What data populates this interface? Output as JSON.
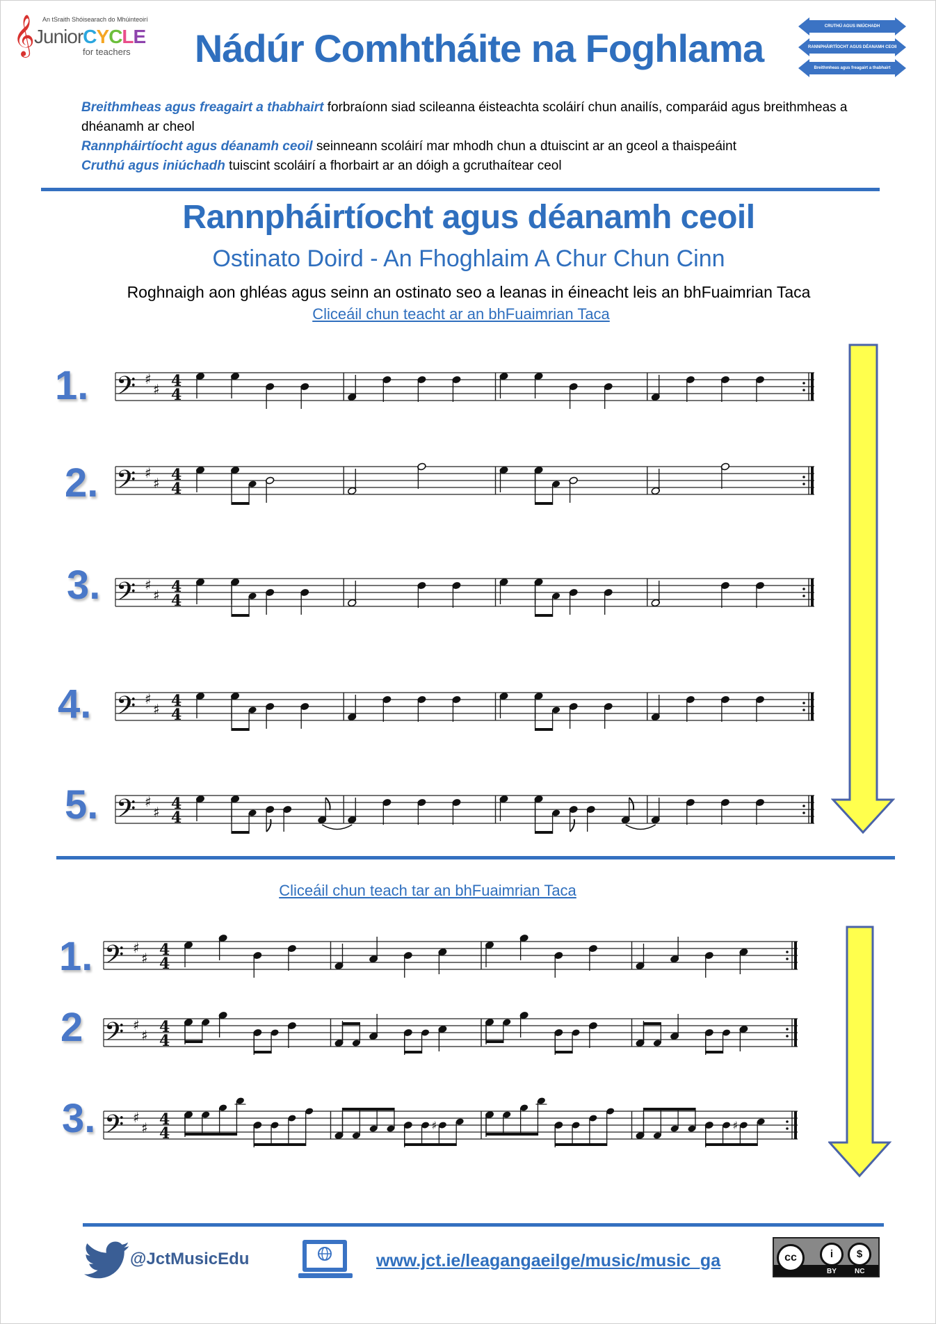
{
  "header": {
    "logo": {
      "tagline": "An tSraith Shóisearach do Mhúinteoirí",
      "junior": "Junior",
      "cycle_letters": [
        "C",
        "Y",
        "C",
        "L",
        "E"
      ],
      "for_teachers": "for teachers"
    },
    "title": "Nádúr Comhtháite na Foghlama",
    "strand_arrows": [
      "CRUTHÚ AGUS INIÚCHADH",
      "RANNPHÁIRTÍOCHT AGUS DÉANAMH CEOIL",
      "Breithmheas agus freagairt a thabhairt"
    ]
  },
  "intro": [
    {
      "emphasis": "Breithmheas agus freagairt a thabhairt",
      "text": " forbraíonn siad scileanna éisteachta scoláirí chun anailís, comparáid agus breithmheas a dhéanamh ar cheol"
    },
    {
      "emphasis": "Rannpháirtíocht agus déanamh ceoil",
      "text": " seinneann scoláirí mar mhodh chun a dtuiscint ar an gceol a thaispeáint"
    },
    {
      "emphasis": "Cruthú agus iniúchadh",
      "text": " tuiscint scoláirí a fhorbairt ar an dóigh a gcruthaítear ceol"
    }
  ],
  "section": {
    "heading": "Rannpháirtíocht agus déanamh ceoil",
    "subheading": "Ostinato Doird - An Fhoghlaim A Chur Chun Cinn",
    "instruction": "Roghnaigh aon ghléas agus seinn an ostinato seo a leanas in éineacht leis an bhFuaimrian Taca",
    "link1": "Cliceáil chun teacht ar an bhFuaimrian Taca",
    "link2": "Cliceáil chun teach tar an bhFuaimrian Taca"
  },
  "music": {
    "clef": "bass",
    "key_signature": [
      "F#",
      "C#"
    ],
    "time_signature": "4/4",
    "end_barline": "repeat",
    "set1": [
      {
        "label": "1.",
        "measures": [
          [
            [
              "G3",
              1
            ],
            [
              "G3",
              1
            ],
            [
              "D3",
              1
            ],
            [
              "D3",
              1
            ]
          ],
          [
            [
              "A2",
              1
            ],
            [
              "F#3",
              1
            ],
            [
              "F#3",
              1
            ],
            [
              "F#3",
              1
            ]
          ],
          [
            [
              "G3",
              1
            ],
            [
              "G3",
              1
            ],
            [
              "D3",
              1
            ],
            [
              "D3",
              1
            ]
          ],
          [
            [
              "A2",
              1
            ],
            [
              "F#3",
              1
            ],
            [
              "F#3",
              1
            ],
            [
              "F#3",
              1
            ]
          ]
        ]
      },
      {
        "label": "2.",
        "measures": [
          [
            [
              "G3",
              1
            ],
            [
              "G3",
              0.5
            ],
            [
              "C#3",
              0.5
            ],
            [
              "D3",
              2
            ]
          ],
          [
            [
              "A2",
              2
            ],
            [
              "A3",
              2
            ]
          ],
          [
            [
              "G3",
              1
            ],
            [
              "G3",
              0.5
            ],
            [
              "C#3",
              0.5
            ],
            [
              "D3",
              2
            ]
          ],
          [
            [
              "A2",
              2
            ],
            [
              "A3",
              2
            ]
          ]
        ]
      },
      {
        "label": "3.",
        "measures": [
          [
            [
              "G3",
              1
            ],
            [
              "G3",
              0.5
            ],
            [
              "C#3",
              0.5
            ],
            [
              "D3",
              1
            ],
            [
              "D3",
              1
            ]
          ],
          [
            [
              "A2",
              2
            ],
            [
              "F#3",
              1
            ],
            [
              "F#3",
              1
            ]
          ],
          [
            [
              "G3",
              1
            ],
            [
              "G3",
              0.5
            ],
            [
              "C#3",
              0.5
            ],
            [
              "D3",
              1
            ],
            [
              "D3",
              1
            ]
          ],
          [
            [
              "A2",
              2
            ],
            [
              "F#3",
              1
            ],
            [
              "F#3",
              1
            ]
          ]
        ]
      },
      {
        "label": "4.",
        "measures": [
          [
            [
              "G3",
              1
            ],
            [
              "G3",
              0.5
            ],
            [
              "C#3",
              0.5
            ],
            [
              "D3",
              1
            ],
            [
              "D3",
              1
            ]
          ],
          [
            [
              "A2",
              1
            ],
            [
              "F#3",
              1
            ],
            [
              "F#3",
              1
            ],
            [
              "F#3",
              1
            ]
          ],
          [
            [
              "G3",
              1
            ],
            [
              "G3",
              0.5
            ],
            [
              "C#3",
              0.5
            ],
            [
              "D3",
              1
            ],
            [
              "D3",
              1
            ]
          ],
          [
            [
              "A2",
              1
            ],
            [
              "F#3",
              1
            ],
            [
              "F#3",
              1
            ],
            [
              "F#3",
              1
            ]
          ]
        ]
      },
      {
        "label": "5.",
        "measures": [
          [
            [
              "G3",
              1
            ],
            [
              "G3",
              0.5
            ],
            [
              "C#3",
              0.5
            ],
            [
              "D3",
              0.5,
              "flag"
            ],
            [
              "D3",
              1
            ],
            [
              "A2",
              0.5,
              "flag-tie"
            ]
          ],
          [
            [
              "A2",
              1
            ],
            [
              "F#3",
              1
            ],
            [
              "F#3",
              1
            ],
            [
              "F#3",
              1
            ]
          ],
          [
            [
              "G3",
              1
            ],
            [
              "G3",
              0.5
            ],
            [
              "C#3",
              0.5
            ],
            [
              "D3",
              0.5,
              "flag"
            ],
            [
              "D3",
              1
            ],
            [
              "A2",
              0.5,
              "flag-tie"
            ]
          ],
          [
            [
              "A2",
              1
            ],
            [
              "F#3",
              1
            ],
            [
              "F#3",
              1
            ],
            [
              "F#3",
              1
            ]
          ]
        ]
      }
    ],
    "set2": [
      {
        "label": "1.",
        "measures": [
          [
            [
              "G3",
              1
            ],
            [
              "B3",
              1
            ],
            [
              "D3",
              1
            ],
            [
              "F#3",
              1
            ]
          ],
          [
            [
              "A2",
              1
            ],
            [
              "C#3",
              1
            ],
            [
              "D3",
              1
            ],
            [
              "E3",
              1
            ]
          ],
          [
            [
              "G3",
              1
            ],
            [
              "B3",
              1
            ],
            [
              "D3",
              1
            ],
            [
              "F#3",
              1
            ]
          ],
          [
            [
              "A2",
              1
            ],
            [
              "C#3",
              1
            ],
            [
              "D3",
              1
            ],
            [
              "E3",
              1
            ]
          ]
        ]
      },
      {
        "label": "2",
        "measures": [
          [
            [
              "G3",
              0.5
            ],
            [
              "G3",
              0.5
            ],
            [
              "B3",
              1
            ],
            [
              "D3",
              0.5
            ],
            [
              "D3",
              0.5
            ],
            [
              "F#3",
              1
            ]
          ],
          [
            [
              "A2",
              0.5
            ],
            [
              "A2",
              0.5
            ],
            [
              "C#3",
              1
            ],
            [
              "D3",
              0.5
            ],
            [
              "D3",
              0.5
            ],
            [
              "E3",
              1
            ]
          ],
          [
            [
              "G3",
              0.5
            ],
            [
              "G3",
              0.5
            ],
            [
              "B3",
              1
            ],
            [
              "D3",
              0.5
            ],
            [
              "D3",
              0.5
            ],
            [
              "F#3",
              1
            ]
          ],
          [
            [
              "A2",
              0.5
            ],
            [
              "A2",
              0.5
            ],
            [
              "C#3",
              1
            ],
            [
              "D3",
              0.5
            ],
            [
              "D3",
              0.5
            ],
            [
              "E3",
              1
            ]
          ]
        ]
      },
      {
        "label": "3.",
        "measures": [
          [
            [
              "G3",
              0.5
            ],
            [
              "G3",
              0.5
            ],
            [
              "B3",
              0.5
            ],
            [
              "D4",
              0.5
            ],
            [
              "D3",
              0.5
            ],
            [
              "D3",
              0.5
            ],
            [
              "F#3",
              0.5
            ],
            [
              "A3",
              0.5
            ]
          ],
          [
            [
              "A2",
              0.5
            ],
            [
              "A2",
              0.5
            ],
            [
              "C#3",
              0.5
            ],
            [
              "C#3",
              0.5
            ],
            [
              "D3",
              0.5
            ],
            [
              "D3",
              0.5
            ],
            [
              "D#3",
              0.5
            ],
            [
              "E3",
              0.5
            ]
          ],
          [
            [
              "G3",
              0.5
            ],
            [
              "G3",
              0.5
            ],
            [
              "B3",
              0.5
            ],
            [
              "D4",
              0.5
            ],
            [
              "D3",
              0.5
            ],
            [
              "D3",
              0.5
            ],
            [
              "F#3",
              0.5
            ],
            [
              "A3",
              0.5
            ]
          ],
          [
            [
              "A2",
              0.5
            ],
            [
              "A2",
              0.5
            ],
            [
              "C#3",
              0.5
            ],
            [
              "C#3",
              0.5
            ],
            [
              "D3",
              0.5
            ],
            [
              "D3",
              0.5
            ],
            [
              "D#3",
              0.5
            ],
            [
              "E3",
              0.5
            ]
          ]
        ]
      }
    ]
  },
  "footer": {
    "twitter_icon": "twitter-bird-icon",
    "twitter_handle": "@JctMusicEdu",
    "web_icon": "laptop-globe-icon",
    "website": "www.jct.ie/leagangaeilge/music/music_ga",
    "license": {
      "cc": "cc",
      "by": "BY",
      "nc": "NC"
    }
  },
  "colors": {
    "brand_blue": "#2f6fbe",
    "number_blue": "#4a78c8",
    "arrow_yellow": "#ffff4d",
    "arrow_outline": "#4a63a8"
  }
}
